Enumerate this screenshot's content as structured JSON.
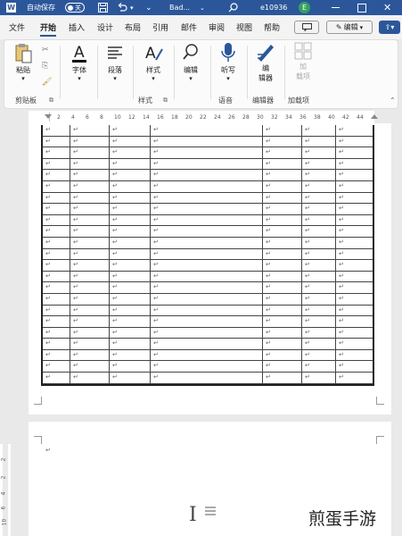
{
  "titlebar": {
    "autosave_label": "自动保存",
    "toggle_state": "关",
    "doc_name": "Bad...",
    "user_id": "e10936",
    "avatar_letter": "E"
  },
  "menu": {
    "tabs": [
      "文件",
      "开始",
      "插入",
      "设计",
      "布局",
      "引用",
      "邮件",
      "审阅",
      "视图",
      "帮助"
    ],
    "edit_mode_label": "编辑"
  },
  "ribbon": {
    "paste_label": "粘贴",
    "font_label": "字体",
    "paragraph_label": "段落",
    "styles_label": "样式",
    "editing_label": "编辑",
    "dictate_label": "听写",
    "editor_label_1": "编",
    "editor_label_2": "辑器",
    "addins_label_1": "加",
    "addins_label_2": "载项",
    "groups": {
      "clipboard": "剪贴板",
      "styles": "样式",
      "voice": "语音",
      "editor": "编辑器",
      "addins": "加载项"
    }
  },
  "ruler": {
    "numbers": [
      "2",
      "4",
      "6",
      "8",
      "10",
      "12",
      "14",
      "16",
      "18",
      "20",
      "22",
      "24",
      "26",
      "28",
      "30",
      "32",
      "34",
      "36",
      "38",
      "40",
      "42",
      "44"
    ]
  },
  "table": {
    "row_count": 23,
    "para_mark": "↵"
  },
  "vruler": {
    "numbers": [
      "2",
      "2",
      "4",
      "6",
      "8",
      "10"
    ]
  },
  "watermark": "煎蛋手游"
}
